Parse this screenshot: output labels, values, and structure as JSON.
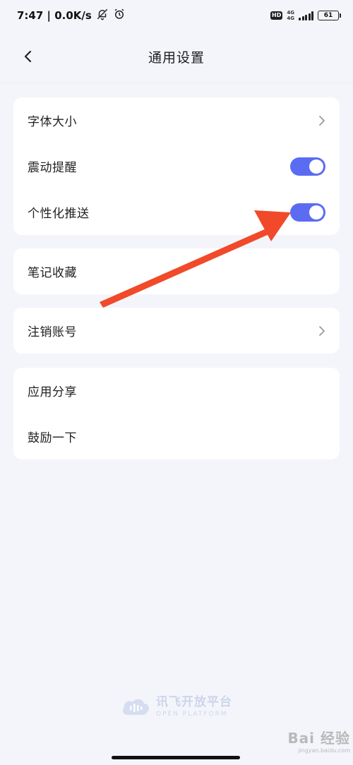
{
  "status_bar": {
    "time_speed": "7:47 | 0.0K/s",
    "hd": "HD",
    "net_top": "4G",
    "net_bottom": "4G",
    "battery": "61"
  },
  "nav": {
    "title": "通用设置"
  },
  "groups": [
    {
      "items": [
        {
          "label": "字体大小",
          "control": "chevron"
        },
        {
          "label": "震动提醒",
          "control": "toggle",
          "on": true
        },
        {
          "label": "个性化推送",
          "control": "toggle",
          "on": true
        }
      ]
    },
    {
      "items": [
        {
          "label": "笔记收藏",
          "control": "none"
        }
      ]
    },
    {
      "items": [
        {
          "label": "注销账号",
          "control": "chevron"
        }
      ]
    },
    {
      "items": [
        {
          "label": "应用分享",
          "control": "none"
        },
        {
          "label": "鼓励一下",
          "control": "none"
        }
      ]
    }
  ],
  "footer": {
    "brand_cn": "讯飞开放平台",
    "brand_en": "OPEN PLATFORM"
  },
  "watermark": {
    "main": "Bai 经验",
    "sub": "jingyan.baidu.com"
  },
  "colors": {
    "toggle_on": "#5b6cf2",
    "arrow": "#f04a2a",
    "background": "#f4f5fb"
  }
}
